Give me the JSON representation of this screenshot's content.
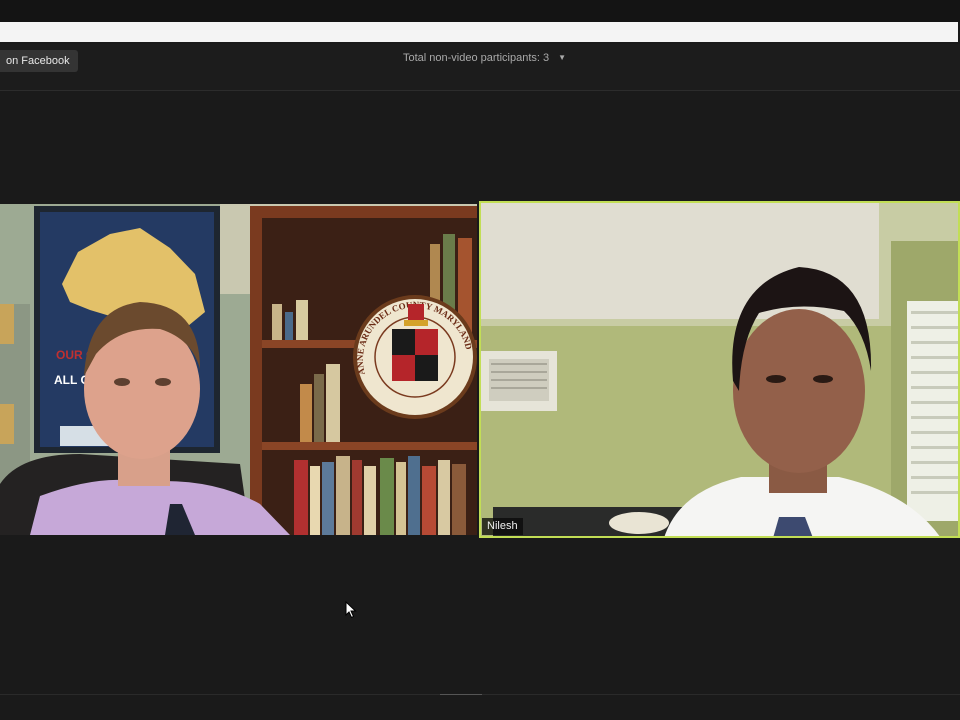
{
  "toolbar": {
    "facebook_label": "on Facebook",
    "participants_text": "Total non-video participants: 3",
    "participants_caret": "▼"
  },
  "videos": {
    "left": {
      "poster_text_1": "OUR CO",
      "poster_text_2": "ALL OF",
      "seal_text": "ANNE ARUNDEL COUNTY MARYLAND"
    },
    "right": {
      "name": "Nilesh"
    }
  },
  "icons": {
    "cursor": "mouse-pointer-icon",
    "dropdown": "caret-down-icon"
  },
  "colors": {
    "background": "#1a1a1a",
    "active_speaker_border": "#c2de55",
    "header_text": "#a9a9a9"
  }
}
